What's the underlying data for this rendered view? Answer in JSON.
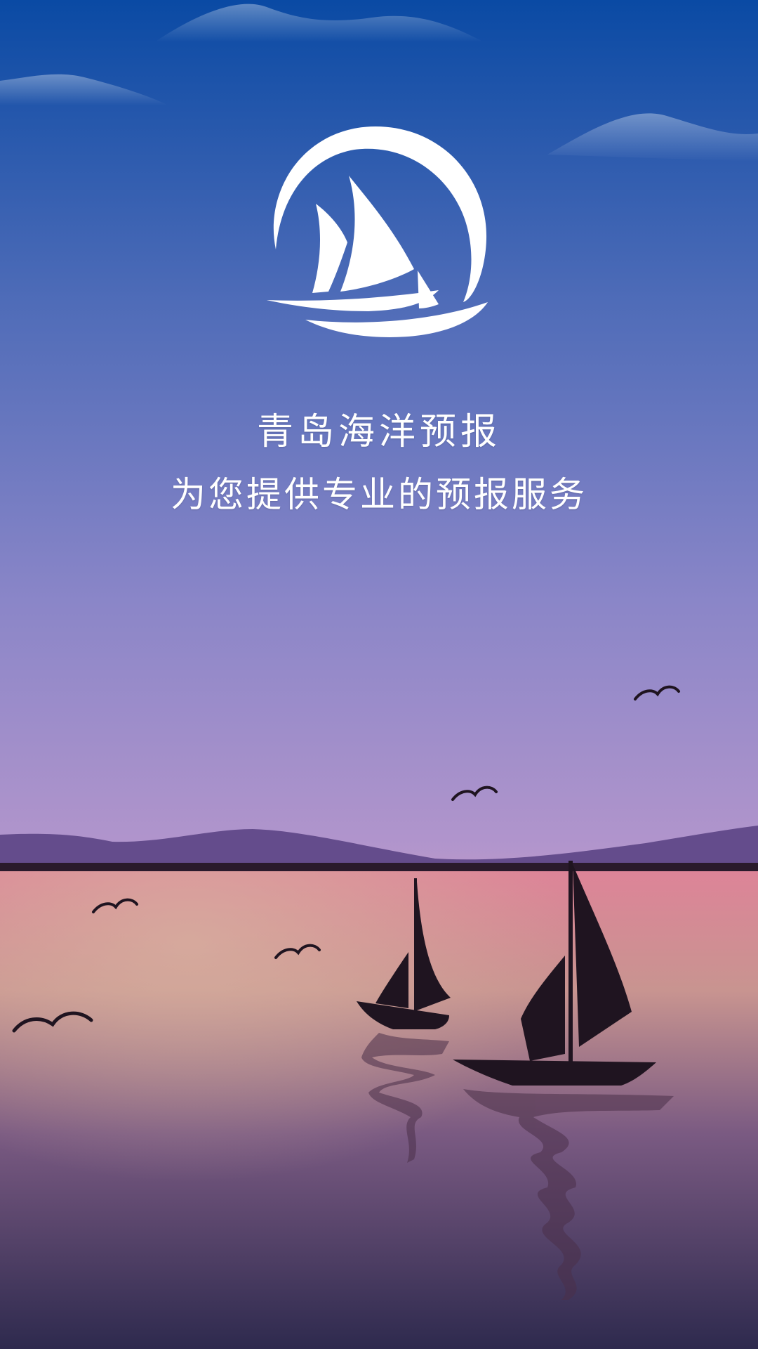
{
  "splash": {
    "app_name": "青岛海洋预报",
    "slogan": "为您提供专业的预报服务",
    "logo_icon": "sailboat-moon-logo-icon"
  },
  "colors": {
    "sky_top": "#0a4aa4",
    "sky_mid": "#7b7fc4",
    "sky_horizon": "#f2b4a0",
    "sea_top": "#e08aa0",
    "sea_bottom": "#2e2a4e",
    "silhouette": "#1f1420",
    "text": "#ffffff"
  }
}
